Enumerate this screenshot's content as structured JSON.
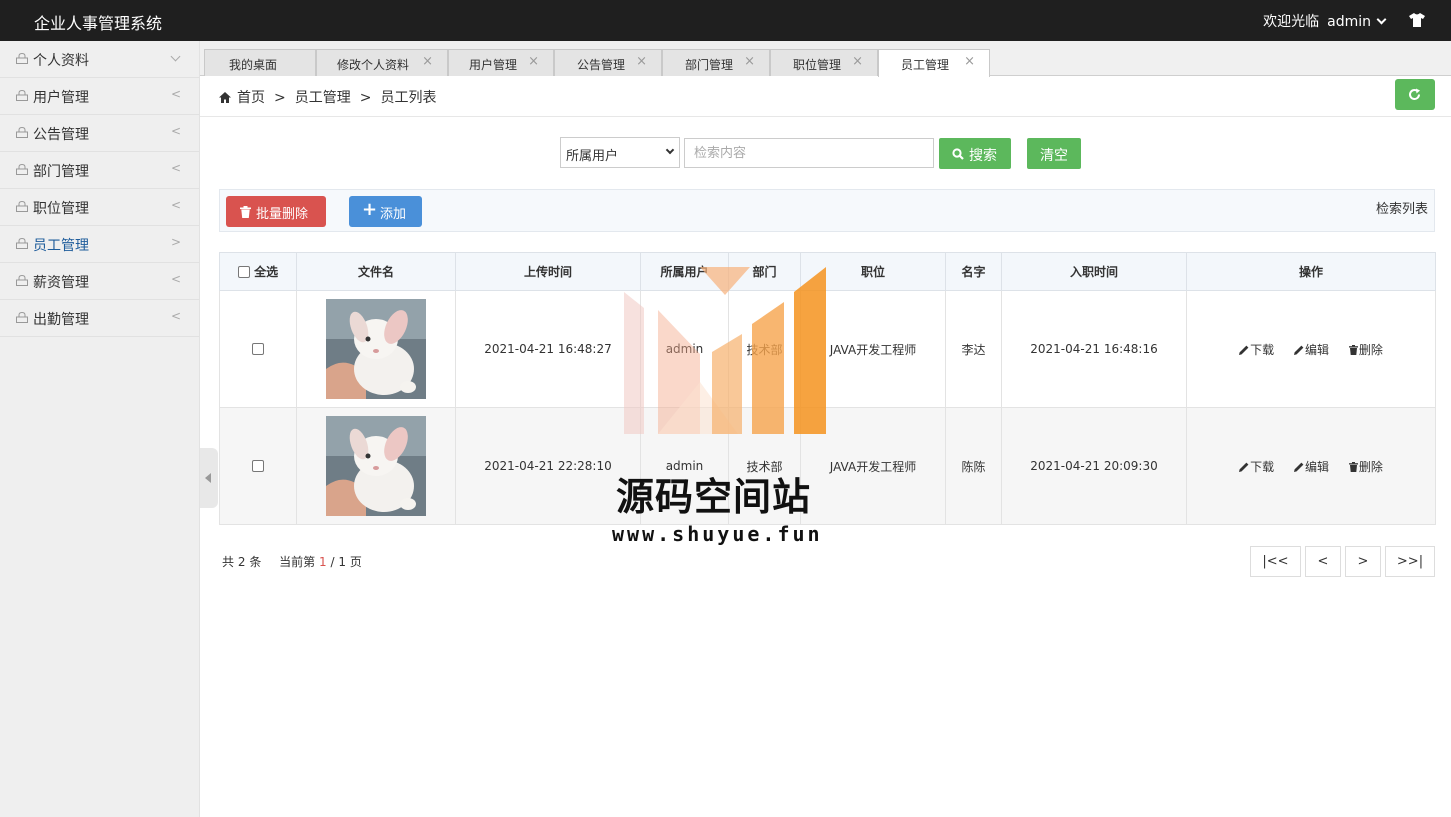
{
  "app": {
    "title": "企业人事管理系统",
    "welcome": "欢迎光临",
    "user": "admin"
  },
  "sidebar": {
    "items": [
      {
        "label": "个人资料",
        "state": "expanded"
      },
      {
        "label": "用户管理",
        "arrow": "<"
      },
      {
        "label": "公告管理",
        "arrow": "<"
      },
      {
        "label": "部门管理",
        "arrow": "<"
      },
      {
        "label": "职位管理",
        "arrow": "<"
      },
      {
        "label": "员工管理",
        "arrow": ">",
        "active": true
      },
      {
        "label": "薪资管理",
        "arrow": "<"
      },
      {
        "label": "出勤管理",
        "arrow": "<"
      }
    ]
  },
  "tabs": [
    {
      "label": "我的桌面"
    },
    {
      "label": "修改个人资料",
      "close": "×"
    },
    {
      "label": "用户管理",
      "close": "×"
    },
    {
      "label": "公告管理",
      "close": "×"
    },
    {
      "label": "部门管理",
      "close": "×"
    },
    {
      "label": "职位管理",
      "close": "×"
    },
    {
      "label": "员工管理",
      "close": "×",
      "active": true
    }
  ],
  "breadcrumb": {
    "home": "首页",
    "sep": ">",
    "level1": "员工管理",
    "level2": "员工列表"
  },
  "search": {
    "select_value": "所属用户",
    "placeholder": "检索内容",
    "search_label": "搜索",
    "clear_label": "清空"
  },
  "toolbar": {
    "batch_delete": "批量删除",
    "add": "添加",
    "right_label": "检索列表"
  },
  "table": {
    "select_all": "全选",
    "headers": [
      "文件名",
      "上传时间",
      "所属用户",
      "部门",
      "职位",
      "名字",
      "入职时间",
      "操作"
    ],
    "actions": {
      "download": "下载",
      "edit": "编辑",
      "delete": "删除"
    },
    "rows": [
      {
        "upload_time": "2021-04-21 16:48:27",
        "user": "admin",
        "dept": "技术部",
        "position": "JAVA开发工程师",
        "name": "李达",
        "join_time": "2021-04-21 16:48:16"
      },
      {
        "upload_time": "2021-04-21 22:28:10",
        "user": "admin",
        "dept": "技术部",
        "position": "JAVA开发工程师",
        "name": "陈陈",
        "join_time": "2021-04-21 20:09:30"
      }
    ]
  },
  "pagination": {
    "total_prefix": "共",
    "total": "2",
    "total_suffix": "条",
    "current_prefix": "当前第",
    "current": "1",
    "slash": "/",
    "pages": "1",
    "pages_suffix": "页",
    "first": "|<<",
    "prev": "<",
    "next": ">",
    "last": ">>|"
  },
  "watermark": {
    "text": "源码空间站",
    "url": "www.shuyue.fun"
  },
  "colors": {
    "topbar": "#1f1f1f",
    "green": "#5cb85c",
    "red": "#d9534f",
    "blue": "#4a90d9",
    "active_nav": "#1e5c9b",
    "watermark_orange": "#f5931e"
  }
}
